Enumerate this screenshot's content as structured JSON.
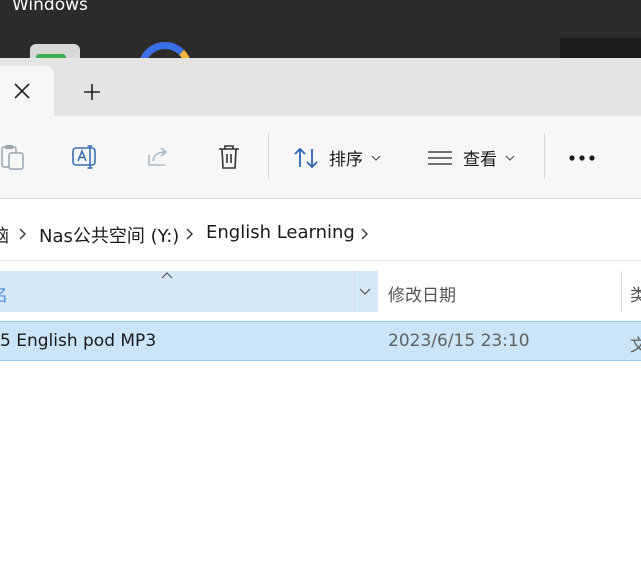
{
  "desktop": {
    "label": "Windows"
  },
  "tabs": {
    "close_icon": "close-icon",
    "new_tab_icon": "plus-icon"
  },
  "toolbar": {
    "paste_icon": "clipboard-icon",
    "rename_icon": "rename-icon",
    "share_icon": "share-icon",
    "delete_icon": "trash-icon",
    "sort_label": "排序",
    "view_label": "查看",
    "more_icon": "more-icon"
  },
  "breadcrumb": {
    "partial": "脑",
    "items": [
      "Nas公共空间 (Y:)",
      "English Learning"
    ]
  },
  "columns": {
    "name_partial": "名",
    "modified": "修改日期",
    "type_partial": "类"
  },
  "rows": [
    {
      "name": "5 English pod MP3",
      "modified": "2023/6/15 23:10",
      "type_partial": "文"
    }
  ],
  "colors": {
    "accent": "#cce4f7",
    "selected_border": "#99c9ef",
    "header_selected": "#d6e8f8"
  }
}
